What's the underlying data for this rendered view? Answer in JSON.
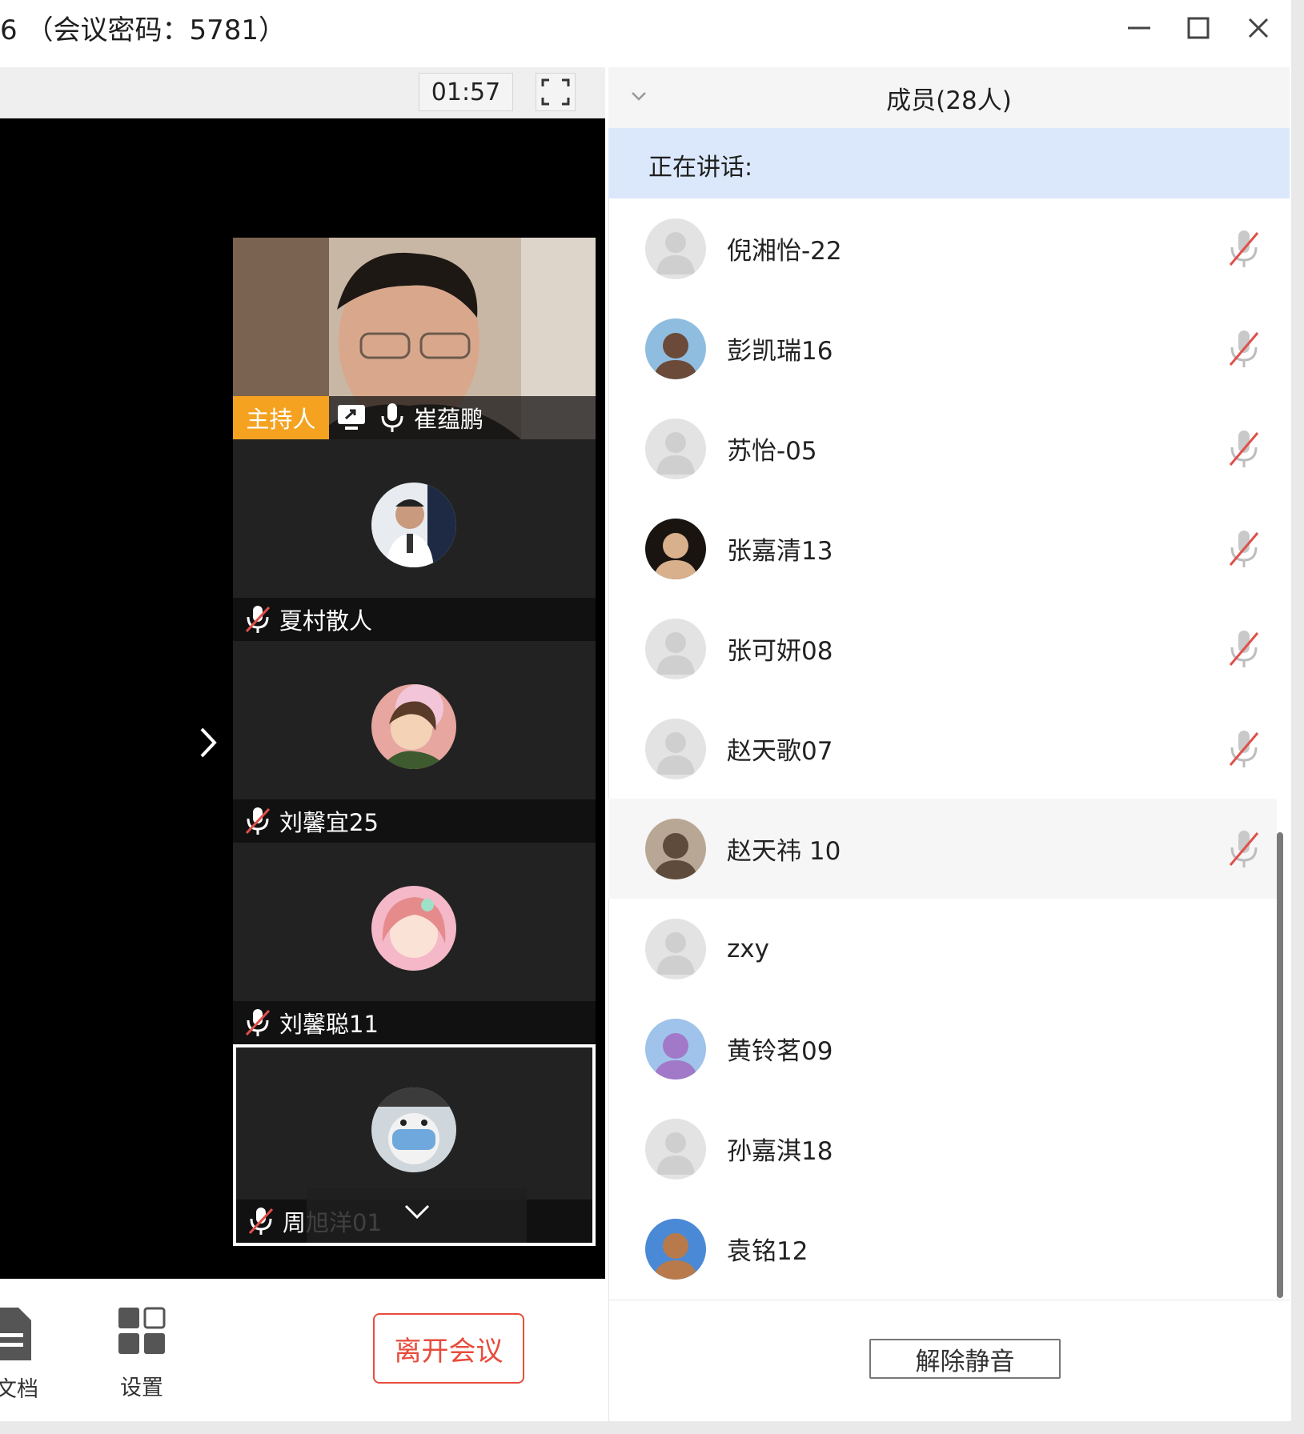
{
  "window": {
    "title": "6 （会议密码：5781）",
    "minimize_icon": "minimize-icon",
    "maximize_icon": "maximize-icon",
    "close_icon": "close-icon"
  },
  "video_toolbar": {
    "timer": "01:57",
    "fullscreen_icon": "fullscreen-icon"
  },
  "video_tiles": [
    {
      "name": "崔蕴鹏",
      "role_badge": "主持人",
      "sharing_icon": "screen-share-icon",
      "mic": "mic-on-icon",
      "avatar_colors": [
        "#c9b7a6",
        "#4a3c34"
      ]
    },
    {
      "name": "夏村散人",
      "mic": "mic-off-icon",
      "avatar_colors": [
        "#e8ecf1",
        "#1e2a44"
      ]
    },
    {
      "name": "刘馨宜25",
      "mic": "mic-off-icon",
      "avatar_colors": [
        "#e7a6a0",
        "#3e5a2f"
      ]
    },
    {
      "name": "刘馨聪11",
      "mic": "mic-off-icon",
      "avatar_colors": [
        "#f4b8c8",
        "#c98a7a"
      ]
    },
    {
      "name": "周旭洋01",
      "mic": "mic-off-icon",
      "avatar_colors": [
        "#6fa8dc",
        "#e8e8e8"
      ]
    }
  ],
  "bottom_toolbar": {
    "documents_label": "会议文档",
    "settings_label": "设置",
    "leave_label": "离开会议"
  },
  "members_panel": {
    "title": "成员(28人)",
    "speaking_label": "正在讲话:",
    "unmute_label": "解除静音",
    "members": [
      {
        "name": "倪湘怡-22",
        "avatar": "default",
        "mic": "mic-off"
      },
      {
        "name": "彭凯瑞16",
        "avatar": "photo",
        "colors": [
          "#8fbde0",
          "#6b4a3a"
        ],
        "mic": "mic-off"
      },
      {
        "name": "苏怡-05",
        "avatar": "default",
        "mic": "mic-off"
      },
      {
        "name": "张嘉清13",
        "avatar": "photo",
        "colors": [
          "#1a1410",
          "#d9b08c"
        ],
        "mic": "mic-off"
      },
      {
        "name": "张可妍08",
        "avatar": "default",
        "mic": "mic-off"
      },
      {
        "name": "赵天歌07",
        "avatar": "default",
        "mic": "mic-off"
      },
      {
        "name": "赵天祎 10",
        "avatar": "photo",
        "colors": [
          "#b9a795",
          "#5e4b3c"
        ],
        "mic": "mic-off"
      },
      {
        "name": "zxy",
        "avatar": "default",
        "mic": "none"
      },
      {
        "name": "黄铃茗09",
        "avatar": "photo",
        "colors": [
          "#9fc3ea",
          "#a279c9"
        ],
        "mic": "none"
      },
      {
        "name": "孙嘉淇18",
        "avatar": "default",
        "mic": "none"
      },
      {
        "name": "袁铭12",
        "avatar": "photo",
        "colors": [
          "#4a89d6",
          "#b87a4b"
        ],
        "mic": "none"
      }
    ]
  },
  "colors": {
    "accent_host": "#f4a21f",
    "leave_red": "#e74c3c",
    "speaking_bg": "#dbe8fb",
    "mic_off_red": "#e0504a"
  }
}
